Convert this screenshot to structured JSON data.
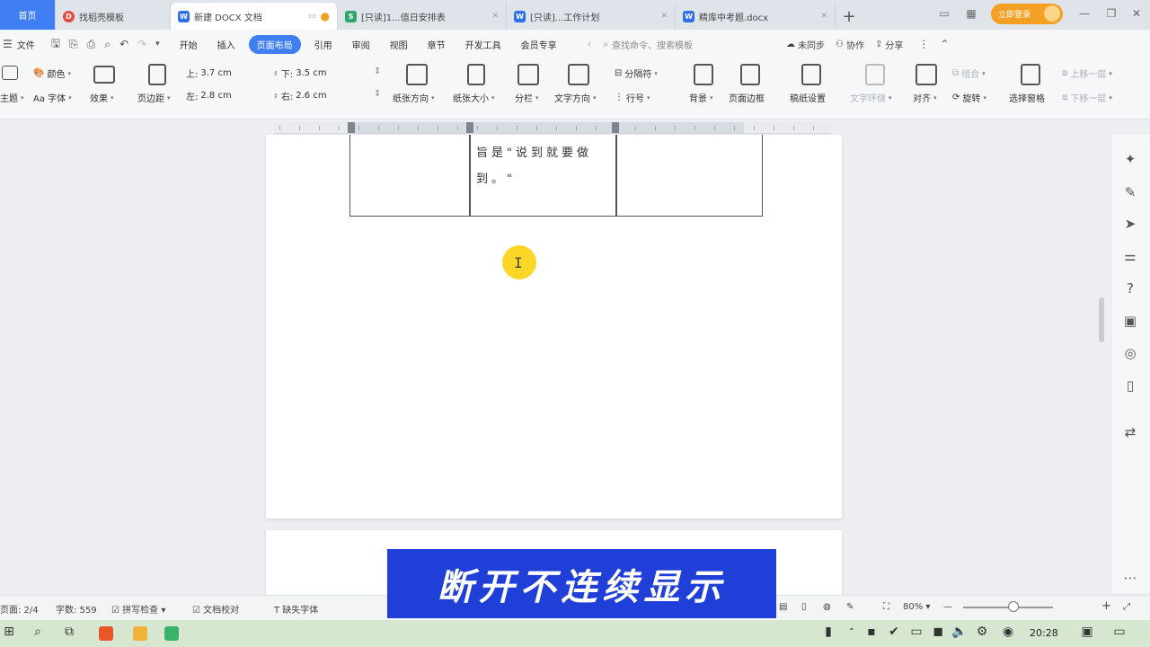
{
  "tabs": {
    "home": "首页",
    "t1": "找稻壳模板",
    "t2": "新建 DOCX 文档",
    "t3": "[只读]1...值日安排表",
    "t4": "[只读]...工作计划",
    "t5": "精库中考题.docx",
    "new_tab": "+"
  },
  "login_button": "立即登录",
  "menu": {
    "file": "文件",
    "start": "开始",
    "insert": "插入",
    "page_layout": "页面布局",
    "reference": "引用",
    "review": "审阅",
    "view": "视图",
    "section": "章节",
    "dev_tools": "开发工具",
    "member": "会员专享",
    "search_placeholder": "查找命令、搜索模板",
    "sync": "未同步",
    "collab": "协作",
    "share": "分享"
  },
  "ribbon": {
    "theme": "主题",
    "color": "颜色",
    "font": "Aa 字体",
    "effect": "效果",
    "margin": "页边距",
    "top_label": "上:",
    "top_value": "3.7 cm",
    "bottom_label": "下:",
    "bottom_value": "3.5 cm",
    "left_label": "左:",
    "left_value": "2.8 cm",
    "right_label": "右:",
    "right_value": "2.6 cm",
    "orientation": "纸张方向",
    "size": "纸张大小",
    "columns": "分栏",
    "text_direction": "文字方向",
    "separator": "分隔符",
    "line_number": "行号",
    "background": "背景",
    "page_border": "页面边框",
    "grid_paper": "稿纸设置",
    "text_wrap": "文字环绕",
    "align": "对齐",
    "rotate": "旋转",
    "selection_pane": "选择窗格",
    "group": "组合",
    "move_up": "上移一层",
    "move_down": "下移一层"
  },
  "document": {
    "cell_text": "旨是\"说到就要做到。\""
  },
  "status": {
    "page": "页面: 2/4",
    "words": "字数: 559",
    "spell": "拼写检查",
    "proofread": "文档校对",
    "missing_font": "缺失字体",
    "zoom": "80%"
  },
  "caption": "断开不连续显示",
  "taskbar": {
    "clock": "20:28"
  }
}
